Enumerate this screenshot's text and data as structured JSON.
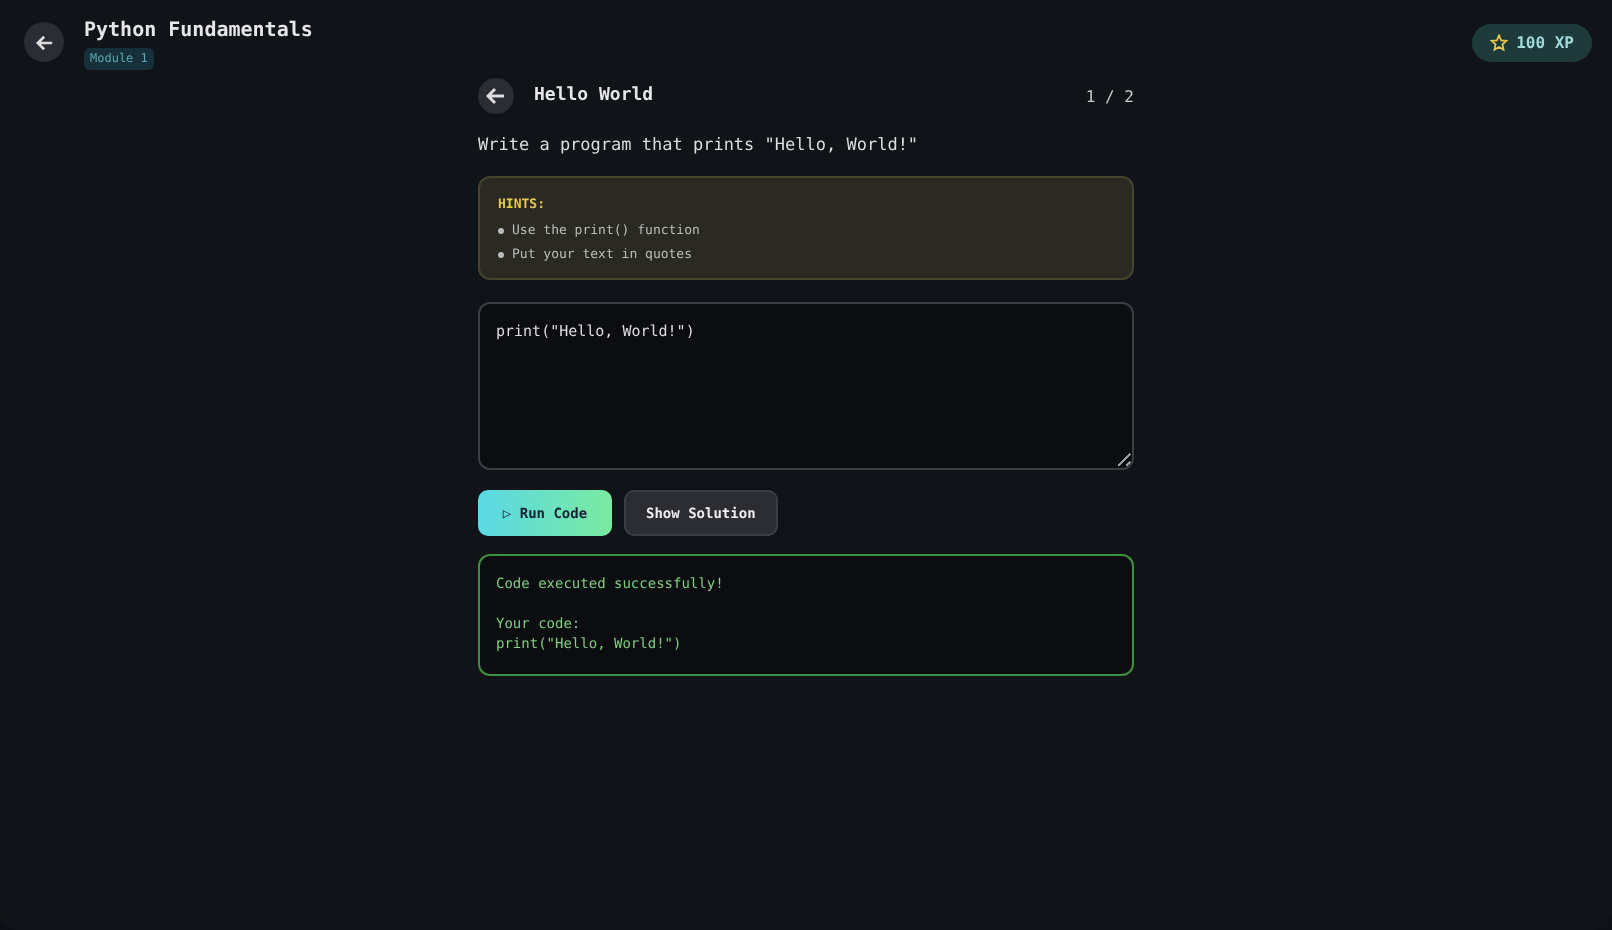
{
  "header": {
    "title": "Python Fundamentals",
    "module": "Module 1",
    "xp": "100 XP"
  },
  "exercise": {
    "title": "Hello World",
    "counter": "1 / 2",
    "prompt": "Write a program that prints \"Hello, World!\""
  },
  "hints": {
    "heading": "HINTS:",
    "items": [
      "Use the print() function",
      "Put your text in quotes"
    ]
  },
  "editor": {
    "value": "print(\"Hello, World!\")"
  },
  "buttons": [
    {
      "kind": "run",
      "label": "Run Code",
      "icon": "▷"
    },
    {
      "kind": "solution",
      "label": "Show Solution"
    }
  ],
  "output": {
    "kind": "success",
    "message": "Code executed successfully!",
    "lines": [
      "Your code:",
      "print(\"Hello, World!\")"
    ]
  }
}
